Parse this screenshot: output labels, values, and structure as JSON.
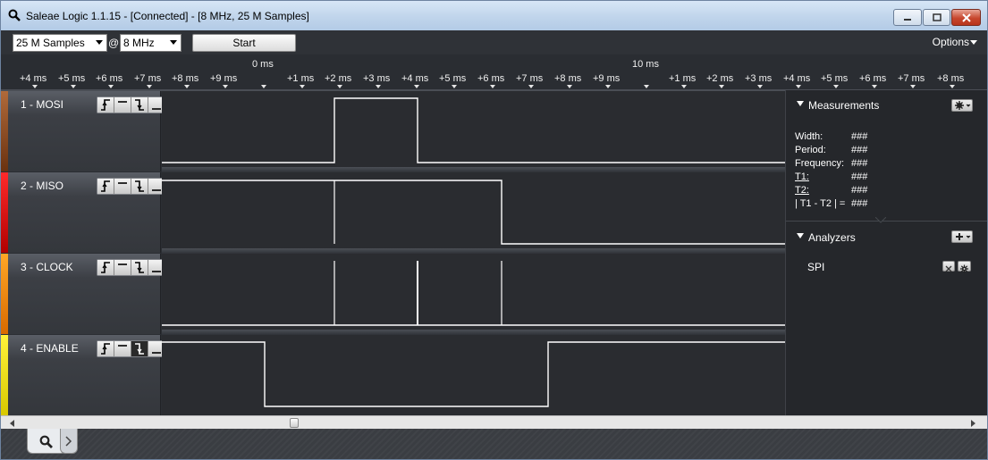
{
  "window": {
    "title": "Saleae Logic 1.1.15 - [Connected] - [8 MHz, 25 M Samples]",
    "icon": "magnifier-icon"
  },
  "toolbar": {
    "samples_value": "25 M Samples",
    "at_label": "@",
    "rate_value": "8 MHz",
    "start_label": "Start",
    "options_label": "Options"
  },
  "ruler": {
    "major_labels": [
      "0 ms",
      "10 ms"
    ],
    "ticks": [
      "+4 ms",
      "+5 ms",
      "+6 ms",
      "+7 ms",
      "+8 ms",
      "+9 ms",
      "+1 ms",
      "+2 ms",
      "+3 ms",
      "+4 ms",
      "+5 ms",
      "+6 ms",
      "+7 ms",
      "+8 ms",
      "+9 ms",
      "+1 ms",
      "+2 ms",
      "+3 ms",
      "+4 ms",
      "+5 ms",
      "+6 ms",
      "+7 ms",
      "+8 ms"
    ]
  },
  "channels": [
    {
      "label": "1 - MOSI",
      "color": "#7a3a14"
    },
    {
      "label": "2 - MISO",
      "color": "#e00000"
    },
    {
      "label": "3 - CLOCK",
      "color": "#f08a00"
    },
    {
      "label": "4 - ENABLE",
      "color": "#f2e600"
    }
  ],
  "measurements": {
    "title": "Measurements",
    "rows": [
      {
        "label": "Width:",
        "value": "###"
      },
      {
        "label": "Period:",
        "value": "###"
      },
      {
        "label": "Frequency:",
        "value": "###"
      },
      {
        "label": "T1:",
        "value": "###"
      },
      {
        "label": "T2:",
        "value": "###"
      },
      {
        "label": "| T1 - T2 | =",
        "value": "###"
      }
    ]
  },
  "analyzers": {
    "title": "Analyzers",
    "items": [
      "SPI"
    ]
  }
}
